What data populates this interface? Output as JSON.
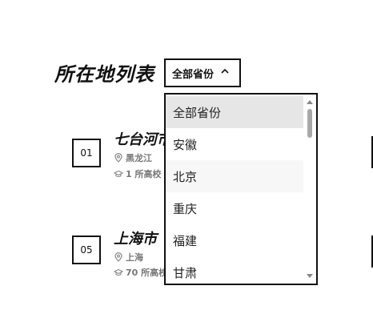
{
  "page": {
    "title": "所在地列表"
  },
  "select": {
    "value": "全部省份",
    "icon": "chevron-up-icon"
  },
  "items": [
    {
      "number": "01",
      "city": "七台河市",
      "province": "黑龙江",
      "schools": "1 所高校"
    },
    {
      "number": "05",
      "city": "上海市",
      "province": "上海",
      "schools": "70 所高校"
    }
  ],
  "dropdown": {
    "options": [
      "全部省份",
      "安徽",
      "北京",
      "重庆",
      "福建",
      "甘肃"
    ],
    "selected": "全部省份"
  },
  "colors": {
    "text": "#111111",
    "meta": "#777777",
    "selected_bg": "#e6e6e6",
    "scroll_thumb": "#a8a8a8"
  }
}
